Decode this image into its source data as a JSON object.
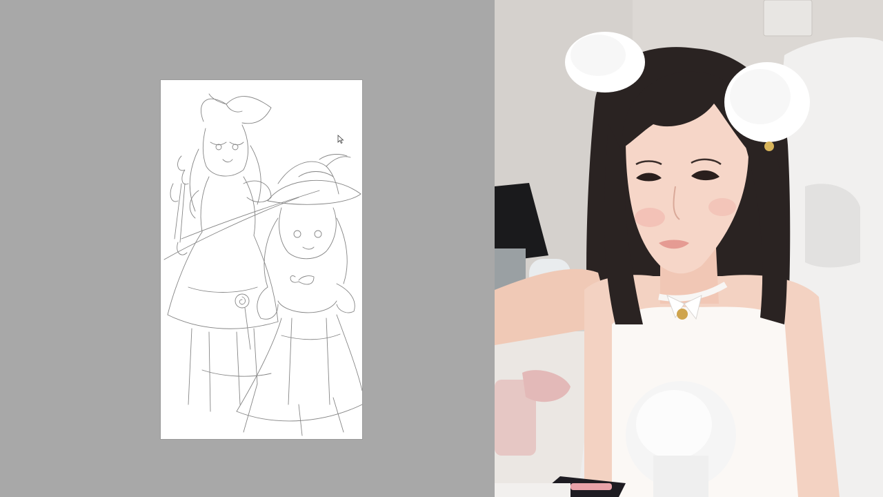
{
  "layout": {
    "left_panel": "drawing-canvas",
    "right_panel": "webcam-feed"
  },
  "drawing": {
    "subject": "pencil-sketch",
    "icons": [
      "arrow-cursor-icon"
    ]
  },
  "webcam": {
    "icons": [
      "cat-ears",
      "bell-choker",
      "microphone",
      "phone"
    ]
  },
  "colors": {
    "background": "#a8a8a8",
    "canvas": "#ffffff",
    "sketch_stroke": "#6e6e6e",
    "wall": "#dcd8d4",
    "hair": "#2a2322"
  }
}
